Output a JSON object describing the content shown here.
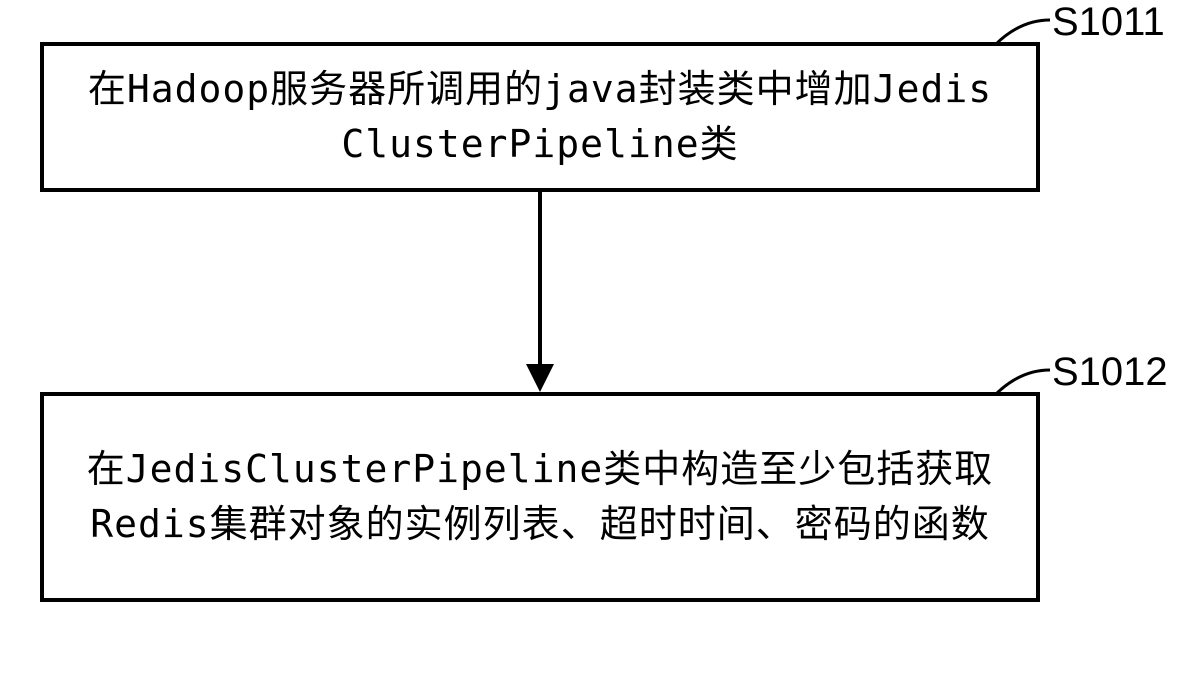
{
  "diagram": {
    "type": "flowchart",
    "steps": [
      {
        "id": "S1011",
        "label": "S1011",
        "text": "在Hadoop服务器所调用的java封装类中增加Jedis ClusterPipeline类"
      },
      {
        "id": "S1012",
        "label": "S1012",
        "text": "在JedisClusterPipeline类中构造至少包括获取Redis集群对象的实例列表、超时时间、密码的函数"
      }
    ]
  }
}
